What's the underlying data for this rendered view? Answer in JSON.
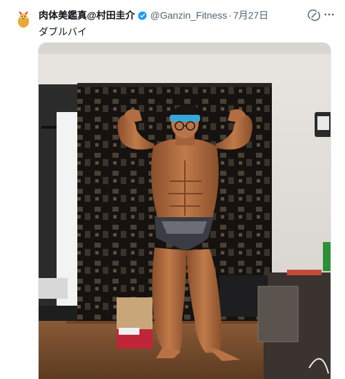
{
  "tweet": {
    "author_name": "肉体美鑑真@村田圭介",
    "handle": "@Ganzin_Fitness",
    "separator": "·",
    "date": "7月27日",
    "text": "ダブルバイ"
  },
  "icons": {
    "verified": "verified-badge-icon",
    "grok": "grok-icon",
    "more": "more-icon"
  },
  "colors": {
    "verified_blue": "#1d9bf0",
    "secondary_text": "#536471"
  }
}
